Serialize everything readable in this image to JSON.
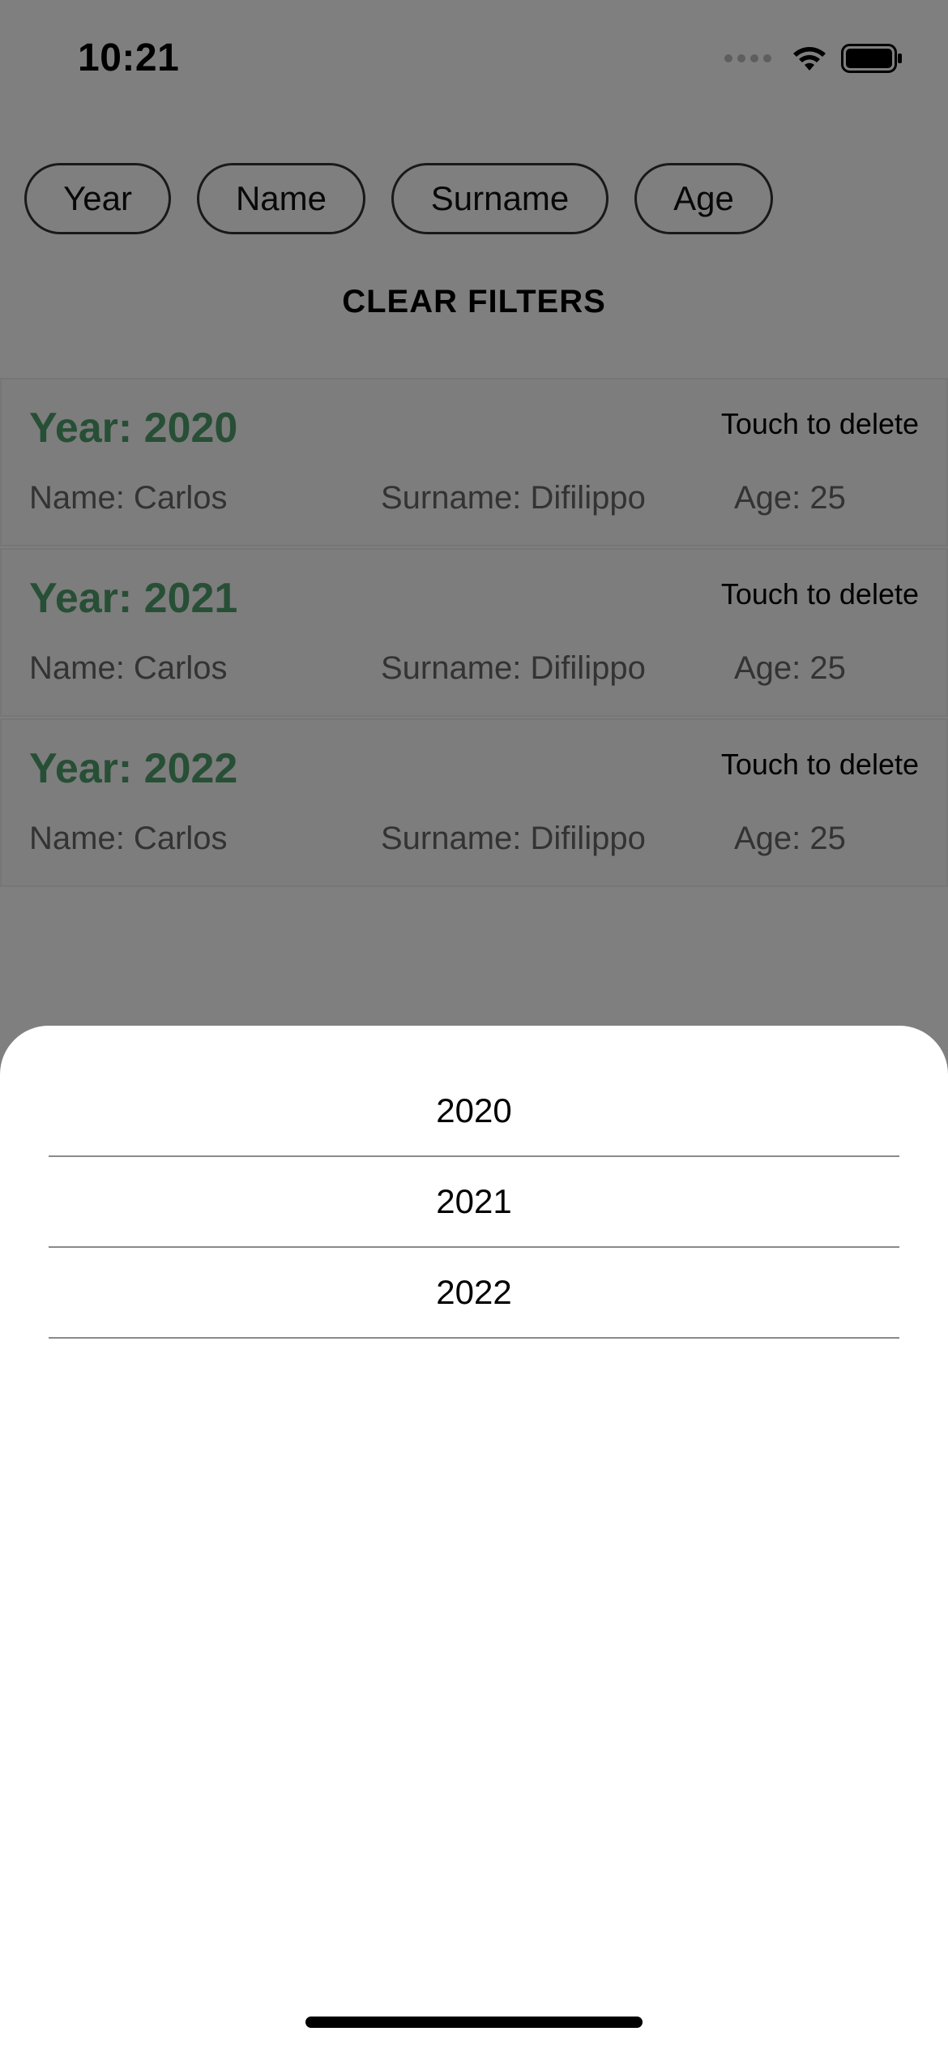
{
  "status_bar": {
    "time": "10:21"
  },
  "filters": {
    "chips": [
      "Year",
      "Name",
      "Surname",
      "Age"
    ],
    "clear_label": "CLEAR FILTERS"
  },
  "records": [
    {
      "year": "Year: 2020",
      "delete": "Touch to delete",
      "name": "Name: Carlos",
      "surname": "Surname: Difilippo",
      "age": "Age: 25"
    },
    {
      "year": "Year: 2021",
      "delete": "Touch to delete",
      "name": "Name: Carlos",
      "surname": "Surname: Difilippo",
      "age": "Age: 25"
    },
    {
      "year": "Year: 2022",
      "delete": "Touch to delete",
      "name": "Name: Carlos",
      "surname": "Surname: Difilippo",
      "age": "Age: 25"
    }
  ],
  "sheet": {
    "options": [
      "2020",
      "2021",
      "2022"
    ]
  },
  "colors": {
    "accent_green": "#4f9f6c",
    "overlay": "rgba(0,0,0,0.5)"
  },
  "icons": {
    "signal": "signal-dots-icon",
    "wifi": "wifi-icon",
    "battery": "battery-icon"
  }
}
